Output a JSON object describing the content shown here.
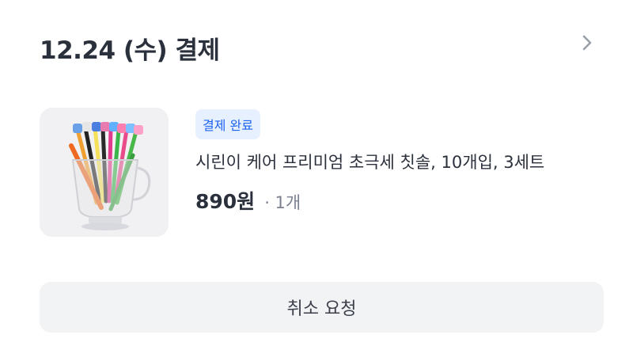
{
  "order": {
    "date_title": "12.24 (수) 결제",
    "status_badge": "결제 완료",
    "product_name": "시린이 케어 프리미엄 초극세 칫솔, 10개입, 3세트",
    "price": "890원",
    "quantity": "· 1개",
    "cancel_label": "취소 요청"
  },
  "icons": {
    "chevron": "chevron-right-icon",
    "thumbnail": "toothbrush-cup-product-image"
  },
  "colors": {
    "badge_bg": "#e6f0ff",
    "badge_text": "#1d64f2",
    "button_bg": "#f2f3f5",
    "text_primary": "#2b313c",
    "text_secondary": "#7b8190"
  }
}
